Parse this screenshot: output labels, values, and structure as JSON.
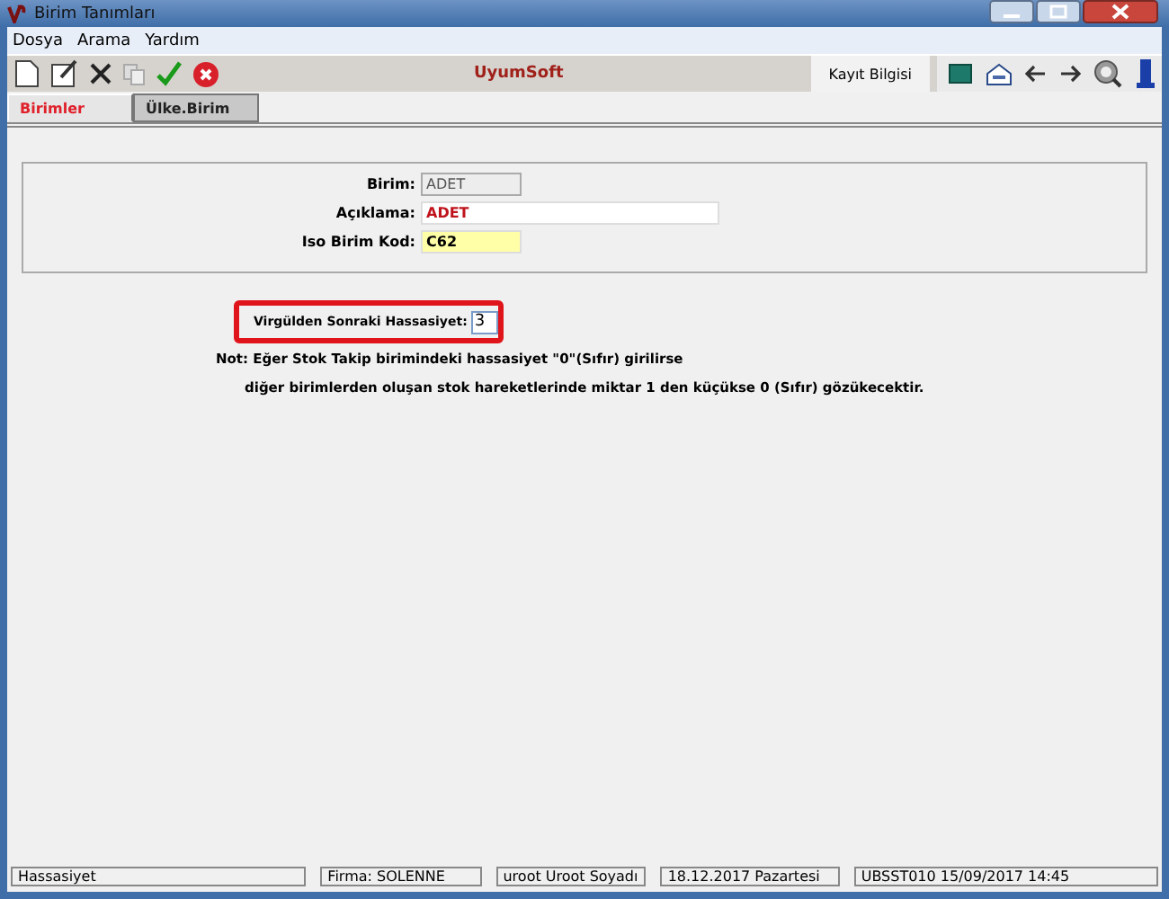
{
  "window": {
    "title": "Birim Tanımları"
  },
  "menu": [
    "Dosya",
    "Arama",
    "Yardım"
  ],
  "toolbar": {
    "brand": "UyumSoft",
    "record_info": "Kayıt Bilgisi"
  },
  "tabs": [
    {
      "label": "Birimler",
      "selected": true
    },
    {
      "label": "Ülke.Birim",
      "selected": false
    }
  ],
  "fields": [
    {
      "label": "Birim:",
      "value": "ADET",
      "kind": "readonly"
    },
    {
      "label": "Açıklama:",
      "value": "ADET",
      "kind": "text"
    },
    {
      "label": "Iso Birim Kod:",
      "value": "C62",
      "kind": "code"
    }
  ],
  "precision": {
    "label": "Virgülden Sonraki Hassasiyet:",
    "value": "3"
  },
  "note": [
    "Not: Eğer Stok Takip birimindeki hassasiyet \"0\"(Sıfır) girilirse",
    "diğer birimlerden oluşan stok hareketlerinde miktar 1 den küçükse 0 (Sıfır) gözükecektir."
  ],
  "status_bar": [
    "Hassasiyet",
    "Firma: SOLENNE",
    "uroot Uroot Soyadı",
    "18.12.2017  Pazartesi",
    "UBSST010 15/09/2017 14:45"
  ]
}
